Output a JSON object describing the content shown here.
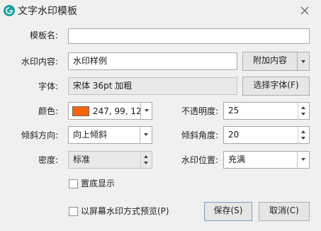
{
  "window": {
    "title": "文字水印模板",
    "close_icon": "close-icon"
  },
  "form": {
    "template_name": {
      "label": "模板名:",
      "value": ""
    },
    "content": {
      "label": "水印内容:",
      "value": "水印样例",
      "attach_button": "附加内容"
    },
    "font": {
      "label": "字体:",
      "value": "宋体 36pt 加粗",
      "select_button": "选择字体(F)"
    },
    "color": {
      "label": "颜色:",
      "value": "247, 99, 12",
      "swatch": "#f7630c"
    },
    "opacity": {
      "label": "不透明度:",
      "value": "25"
    },
    "tilt_direction": {
      "label": "倾斜方向:",
      "value": "向上倾斜"
    },
    "tilt_angle": {
      "label": "倾斜角度:",
      "value": "20"
    },
    "density": {
      "label": "密度:",
      "value": "标准"
    },
    "position": {
      "label": "水印位置:",
      "value": "充满"
    },
    "bottom_layer": {
      "label": "置底显示",
      "checked": false
    },
    "screen_preview": {
      "label": "以屏幕水印方式预览(P)",
      "checked": false
    }
  },
  "buttons": {
    "save": "保存(S)",
    "cancel": "取消(C)"
  },
  "colors": {
    "accent": "#1aa39a",
    "swatch": "#f7630c"
  }
}
